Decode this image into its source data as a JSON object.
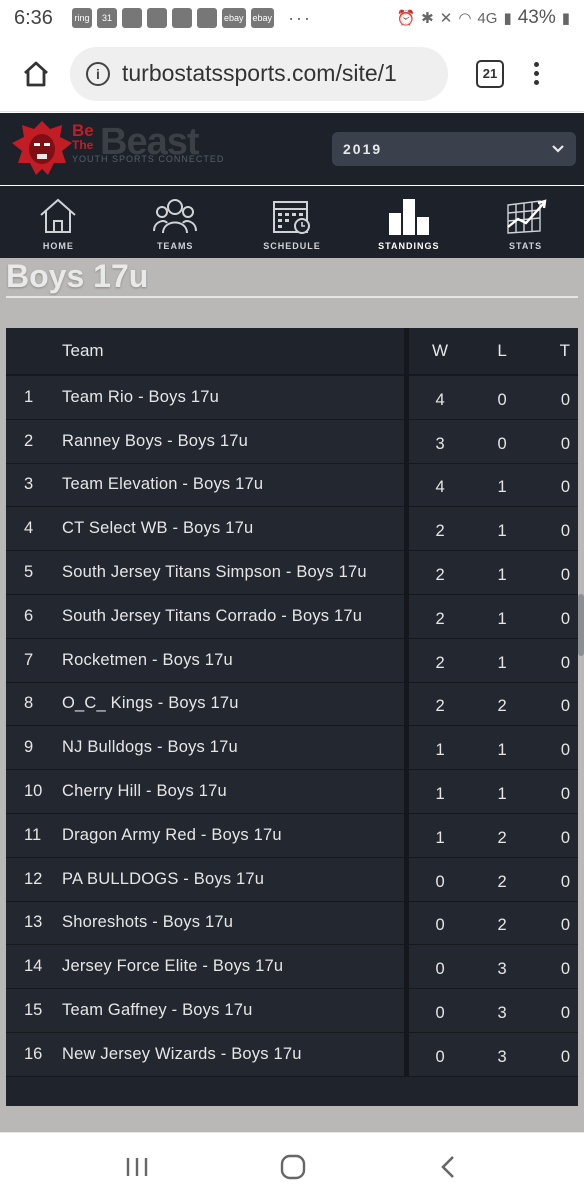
{
  "status_bar": {
    "time": "6:36",
    "notifications": [
      "ring",
      "31",
      "ebay",
      "ebay"
    ],
    "overflow": "···",
    "network": "4G",
    "battery": "43%"
  },
  "browser": {
    "url": "turbostatssports.com/site/1",
    "tab_count": "21"
  },
  "site": {
    "brand_be": "Be",
    "brand_the": "The",
    "brand_beast": "Beast",
    "tagline": "YOUTH SPORTS CONNECTED",
    "year": "2019",
    "accent_color": "#c21d24"
  },
  "nav": {
    "items": [
      {
        "label": "HOME",
        "icon": "home-icon"
      },
      {
        "label": "TEAMS",
        "icon": "teams-icon"
      },
      {
        "label": "SCHEDULE",
        "icon": "calendar-icon"
      },
      {
        "label": "STANDINGS",
        "icon": "standings-icon",
        "active": true
      },
      {
        "label": "STATS",
        "icon": "stats-chart-icon"
      }
    ]
  },
  "page": {
    "title": "Boys 17u"
  },
  "standings": {
    "headers": {
      "team": "Team",
      "w": "W",
      "l": "L",
      "t": "T"
    },
    "rows": [
      {
        "rank": "1",
        "team": "Team Rio - Boys 17u",
        "w": "4",
        "l": "0",
        "t": "0"
      },
      {
        "rank": "2",
        "team": "Ranney Boys - Boys 17u",
        "w": "3",
        "l": "0",
        "t": "0"
      },
      {
        "rank": "3",
        "team": "Team Elevation - Boys 17u",
        "w": "4",
        "l": "1",
        "t": "0"
      },
      {
        "rank": "4",
        "team": "CT Select WB - Boys 17u",
        "w": "2",
        "l": "1",
        "t": "0"
      },
      {
        "rank": "5",
        "team": "South Jersey Titans Simpson - Boys 17u",
        "w": "2",
        "l": "1",
        "t": "0"
      },
      {
        "rank": "6",
        "team": "South Jersey Titans Corrado - Boys 17u",
        "w": "2",
        "l": "1",
        "t": "0"
      },
      {
        "rank": "7",
        "team": "Rocketmen - Boys 17u",
        "w": "2",
        "l": "1",
        "t": "0"
      },
      {
        "rank": "8",
        "team": "O_C_ Kings - Boys 17u",
        "w": "2",
        "l": "2",
        "t": "0"
      },
      {
        "rank": "9",
        "team": "NJ Bulldogs - Boys 17u",
        "w": "1",
        "l": "1",
        "t": "0"
      },
      {
        "rank": "10",
        "team": "Cherry Hill - Boys 17u",
        "w": "1",
        "l": "1",
        "t": "0"
      },
      {
        "rank": "11",
        "team": "Dragon Army Red - Boys 17u",
        "w": "1",
        "l": "2",
        "t": "0"
      },
      {
        "rank": "12",
        "team": "PA BULLDOGS - Boys 17u",
        "w": "0",
        "l": "2",
        "t": "0"
      },
      {
        "rank": "13",
        "team": "Shoreshots - Boys 17u",
        "w": "0",
        "l": "2",
        "t": "0"
      },
      {
        "rank": "14",
        "team": "Jersey Force Elite - Boys 17u",
        "w": "0",
        "l": "3",
        "t": "0"
      },
      {
        "rank": "15",
        "team": "Team Gaffney - Boys 17u",
        "w": "0",
        "l": "3",
        "t": "0"
      },
      {
        "rank": "16",
        "team": "New Jersey Wizards - Boys 17u",
        "w": "0",
        "l": "3",
        "t": "0"
      }
    ]
  }
}
